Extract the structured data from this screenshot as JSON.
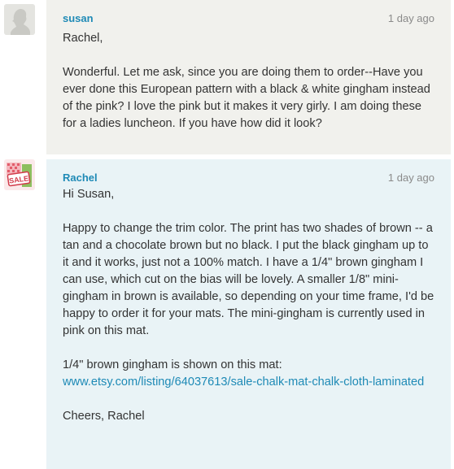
{
  "messages": [
    {
      "sender": "susan",
      "timestamp": "1 day ago",
      "avatar_icon": "silhouette-avatar-icon",
      "greeting": "Rachel,",
      "paragraphs": [
        "Wonderful. Let me ask, since you are doing them to order--Have you ever done this European pattern with a black & white gingham instead of the pink? I love the pink but it makes it very girly. I am doing these for a ladies luncheon. If you have how did it look?"
      ]
    },
    {
      "sender": "Rachel",
      "timestamp": "1 day ago",
      "avatar_icon": "sale-shop-avatar-icon",
      "avatar_text": "SALE",
      "greeting": "Hi Susan,",
      "paragraphs": [
        "Happy to change the trim color. The print has two shades of brown -- a tan and a chocolate brown but no black. I put the black gingham up to it and it works, just not a 100% match. I have a 1/4\" brown gingham I can use, which cut on the bias will be lovely. A smaller 1/8\" mini-gingham in brown is available, so depending on your time frame, I'd be happy to order it for your mats. The mini-gingham is currently used in pink on this mat.",
        "1/4\" brown gingham is shown on this mat:"
      ],
      "link": "www.etsy.com/listing/64037613/sale-chalk-mat-chalk-cloth-laminated",
      "closing": "Cheers, Rachel"
    }
  ],
  "colors": {
    "link": "#1e8ab6",
    "susan_bg": "#f1f1ed",
    "rachel_bg": "#e9f3f6",
    "timestamp": "#8a8a8a",
    "body_text": "#333333"
  }
}
